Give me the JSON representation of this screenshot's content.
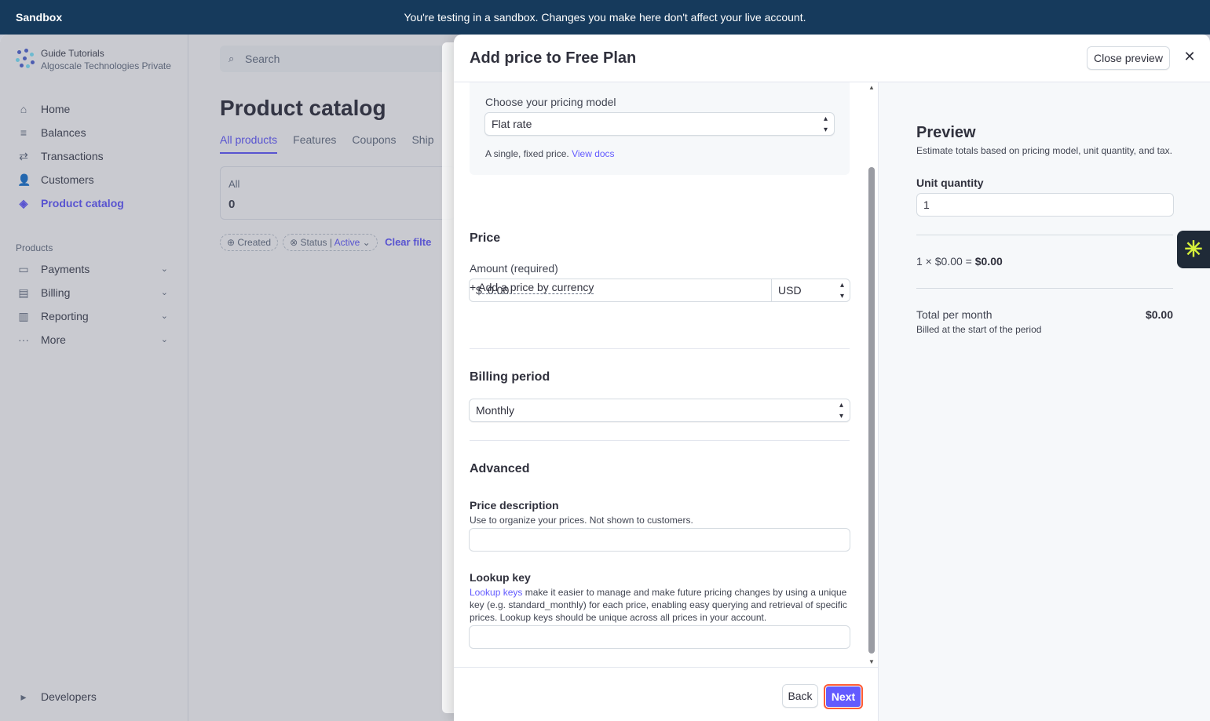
{
  "banner": {
    "brand": "Sandbox",
    "message": "You're testing in a sandbox. Changes you make here don't affect your live account."
  },
  "sidebar": {
    "account_name": "Guide Tutorials",
    "account_org": "Algoscale Technologies Private I",
    "items": [
      {
        "label": "Home",
        "icon": "home-icon"
      },
      {
        "label": "Balances",
        "icon": "balances-icon"
      },
      {
        "label": "Transactions",
        "icon": "transactions-icon"
      },
      {
        "label": "Customers",
        "icon": "customers-icon"
      },
      {
        "label": "Product catalog",
        "icon": "product-catalog-icon",
        "active": true
      }
    ],
    "products_heading": "Products",
    "product_items": [
      {
        "label": "Payments",
        "icon": "payments-icon"
      },
      {
        "label": "Billing",
        "icon": "billing-icon"
      },
      {
        "label": "Reporting",
        "icon": "reporting-icon"
      },
      {
        "label": "More",
        "icon": "more-icon"
      }
    ],
    "developers": "Developers"
  },
  "main": {
    "search_placeholder": "Search",
    "title": "Product catalog",
    "tabs": [
      "All products",
      "Features",
      "Coupons",
      "Ship"
    ],
    "summary_label": "All",
    "summary_value": "0",
    "filters": {
      "created": "Created",
      "status": "Status",
      "status_value": "Active",
      "clear": "Clear filte"
    }
  },
  "drawer": {
    "title": "Add price to Free Plan",
    "close_preview": "Close preview",
    "pricing_model_label": "Choose your pricing model",
    "pricing_model_value": "Flat rate",
    "pricing_model_help": "A single, fixed price.",
    "view_docs": "View docs",
    "price_heading": "Price",
    "amount_label": "Amount (required)",
    "currency_symbol": "$",
    "amount_placeholder": "0.00",
    "currency": "USD",
    "add_currency": "Add a price by currency",
    "billing_heading": "Billing period",
    "billing_value": "Monthly",
    "advanced_heading": "Advanced",
    "price_desc_label": "Price description",
    "price_desc_help": "Use to organize your prices. Not shown to customers.",
    "lookup_label": "Lookup key",
    "lookup_link": "Lookup keys",
    "lookup_help": " make it easier to manage and make future pricing changes by using a unique key (e.g. standard_monthly) for each price, enabling easy querying and retrieval of specific prices. Lookup keys should be unique across all prices in your account.",
    "back": "Back",
    "next": "Next"
  },
  "preview": {
    "title": "Preview",
    "subtitle": "Estimate totals based on pricing model, unit quantity, and tax.",
    "unit_quantity_label": "Unit quantity",
    "unit_quantity_value": "1",
    "calc_prefix": "1 × $0.00 = ",
    "calc_total": "$0.00",
    "total_label": "Total per month",
    "total_value": "$0.00",
    "billed_note": "Billed at the start of the period"
  },
  "colors": {
    "accent": "#635bff",
    "banner": "#163a5c",
    "next_outline": "#ff5c35"
  }
}
